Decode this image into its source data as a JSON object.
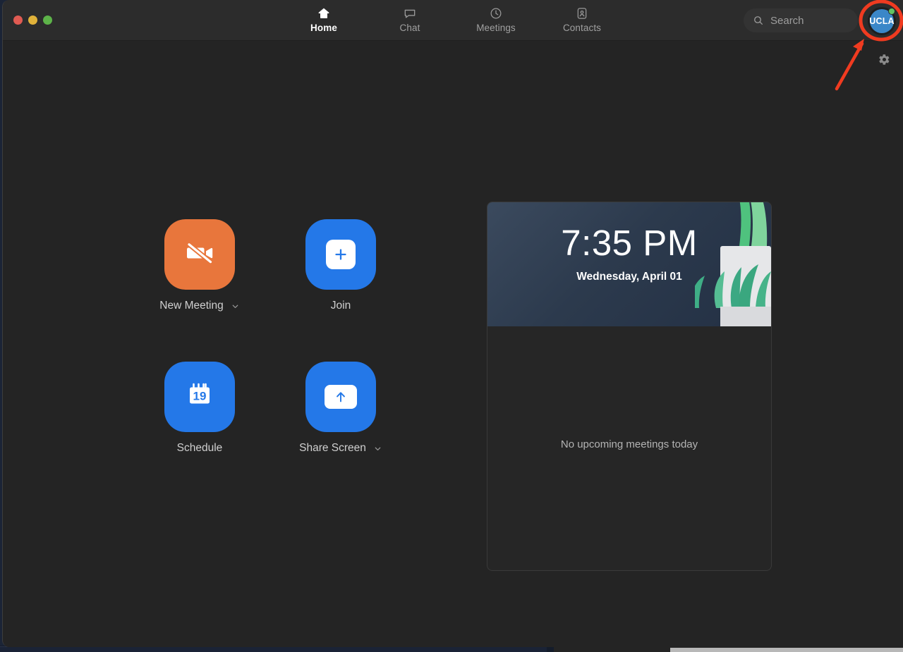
{
  "window": {
    "traffic_lights": [
      {
        "name": "close",
        "color": "#e05b52"
      },
      {
        "name": "minimize",
        "color": "#e0b23a"
      },
      {
        "name": "zoom",
        "color": "#5db349"
      }
    ]
  },
  "nav": {
    "tabs": [
      {
        "label": "Home",
        "icon": "home-icon",
        "active": true
      },
      {
        "label": "Chat",
        "icon": "chat-bubble-icon",
        "active": false
      },
      {
        "label": "Meetings",
        "icon": "clock-icon",
        "active": false
      },
      {
        "label": "Contacts",
        "icon": "contact-card-icon",
        "active": false
      }
    ]
  },
  "search": {
    "placeholder": "Search",
    "value": "",
    "icon": "search-icon"
  },
  "account": {
    "initials": "UCLA",
    "avatar_color": "#3b87c8",
    "status": "available",
    "status_color": "#62c462"
  },
  "settings": {
    "icon": "gear-icon",
    "label": "Settings"
  },
  "actions": [
    {
      "label": "New Meeting",
      "icon": "video-camera-off-icon",
      "color": "#e8763c",
      "has_caret": true
    },
    {
      "label": "Join",
      "icon": "plus-icon",
      "color": "#2478e8",
      "has_caret": false
    },
    {
      "label": "Schedule",
      "icon": "calendar-19-icon",
      "color": "#2478e8",
      "has_caret": false,
      "calendar_day": "19"
    },
    {
      "label": "Share Screen",
      "icon": "share-screen-up-arrow-icon",
      "color": "#2478e8",
      "has_caret": true
    }
  ],
  "meeting_panel": {
    "time": "7:35 PM",
    "date": "Wednesday, April 01",
    "empty_message": "No upcoming meetings today",
    "banner_color": "#2c3a4d"
  },
  "annotation": {
    "highlight_color": "#f03b20",
    "target": "account-avatar",
    "shape": "circle-with-arrow"
  }
}
